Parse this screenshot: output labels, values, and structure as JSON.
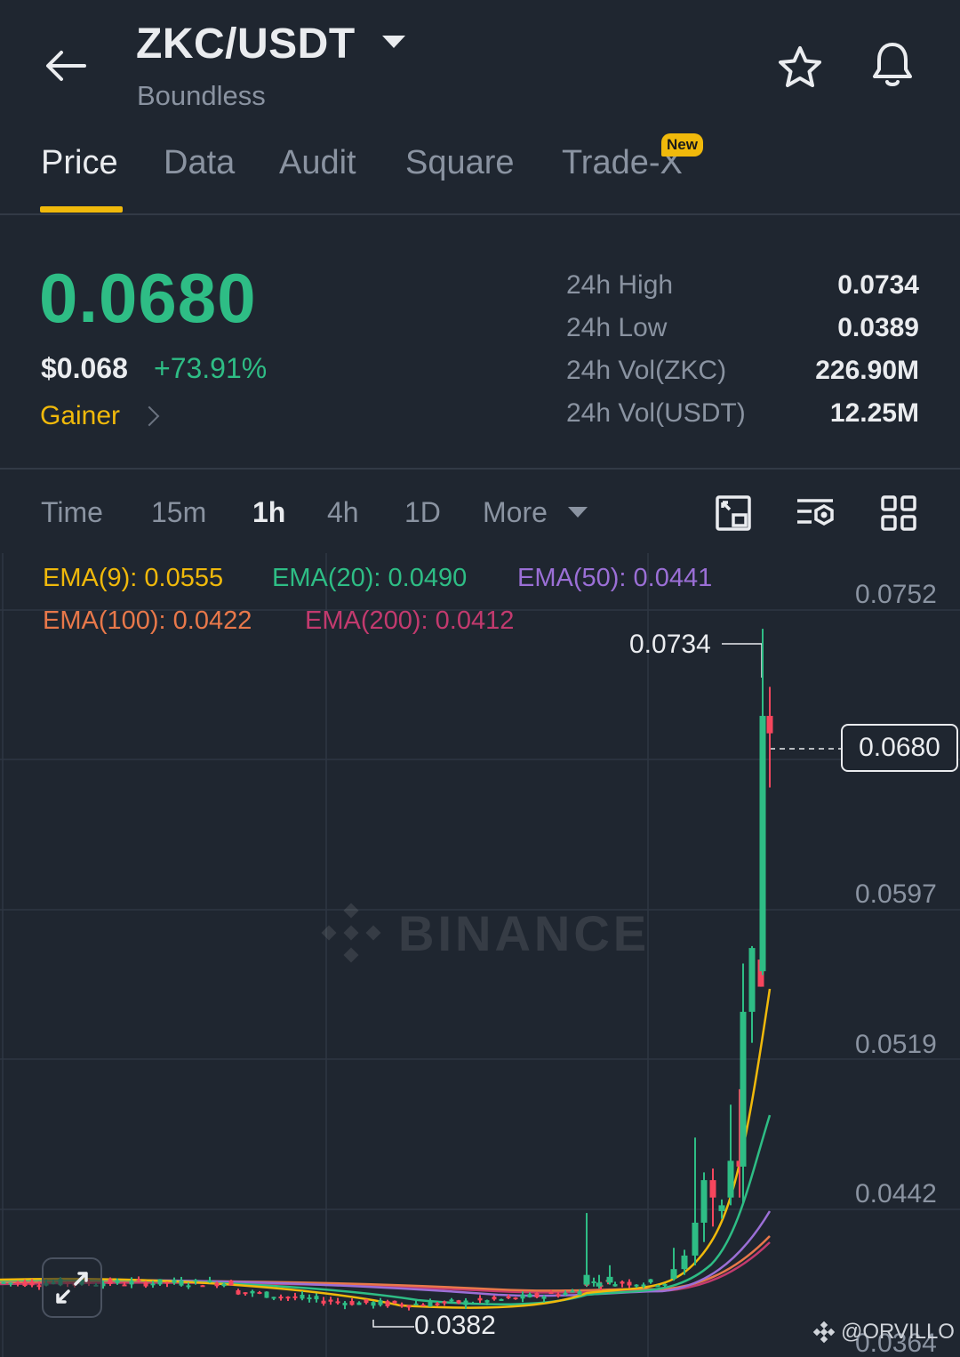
{
  "header": {
    "pair": "ZKC/USDT",
    "subtitle": "Boundless",
    "icons": [
      "back-arrow-icon",
      "caret-down-icon",
      "star-icon",
      "bell-icon"
    ]
  },
  "tabs": {
    "items": [
      {
        "label": "Price",
        "active": true
      },
      {
        "label": "Data"
      },
      {
        "label": "Audit"
      },
      {
        "label": "Square"
      },
      {
        "label": "Trade-X"
      }
    ],
    "new_badge": "New"
  },
  "price": {
    "last": "0.0680",
    "usd": "$0.068",
    "change": "+73.91%",
    "tag": "Gainer",
    "stats": [
      {
        "label": "24h High",
        "value": "0.0734"
      },
      {
        "label": "24h Low",
        "value": "0.0389"
      },
      {
        "label": "24h Vol(ZKC)",
        "value": "226.90M"
      },
      {
        "label": "24h Vol(USDT)",
        "value": "12.25M"
      }
    ]
  },
  "timeframes": {
    "items": [
      "Time",
      "15m",
      "1h",
      "4h",
      "1D",
      "More"
    ],
    "active": "1h",
    "tools": [
      "chart-type-icon",
      "indicator-settings-icon",
      "grid-layout-icon"
    ]
  },
  "chart": {
    "ema": [
      {
        "label": "EMA(9): 0.0555",
        "color": "#f0b90b"
      },
      {
        "label": "EMA(20): 0.0490",
        "color": "#2ebd85"
      },
      {
        "label": "EMA(50): 0.0441",
        "color": "#9b6fd6"
      },
      {
        "label": "EMA(100): 0.0422",
        "color": "#e8784a"
      },
      {
        "label": "EMA(200): 0.0412",
        "color": "#c23a6e"
      }
    ],
    "y_axis": [
      "0.0752",
      "0.0597",
      "0.0519",
      "0.0442",
      "0.0364"
    ],
    "current": "0.0680",
    "high_marker": "0.0734",
    "low_marker": "0.0382",
    "watermark": "BINANCE",
    "credit": "@ORVILLO",
    "up_color": "#2ebd85",
    "down_color": "#f6465d"
  },
  "chart_data": {
    "type": "candlestick",
    "interval": "1h",
    "ylim": [
      0.0364,
      0.0752
    ],
    "y_ticks": [
      0.0752,
      0.0597,
      0.0519,
      0.0442,
      0.0364
    ],
    "last_price": 0.068,
    "high": 0.0734,
    "low": 0.0382,
    "ema": {
      "EMA9": 0.0555,
      "EMA20": 0.049,
      "EMA50": 0.0441,
      "EMA100": 0.0422,
      "EMA200": 0.0412
    },
    "recent_candles": [
      {
        "open": 0.0395,
        "high": 0.0432,
        "low": 0.0394,
        "close": 0.04
      },
      {
        "open": 0.0394,
        "high": 0.04,
        "low": 0.0393,
        "close": 0.0396
      },
      {
        "open": 0.0396,
        "high": 0.0405,
        "low": 0.0395,
        "close": 0.0399
      },
      {
        "open": 0.0398,
        "high": 0.0414,
        "low": 0.0397,
        "close": 0.0403
      },
      {
        "open": 0.0403,
        "high": 0.0413,
        "low": 0.04,
        "close": 0.041
      },
      {
        "open": 0.041,
        "high": 0.0471,
        "low": 0.0405,
        "close": 0.0427
      },
      {
        "open": 0.0427,
        "high": 0.0453,
        "low": 0.0417,
        "close": 0.0449
      },
      {
        "open": 0.0449,
        "high": 0.0455,
        "low": 0.0425,
        "close": 0.044
      },
      {
        "open": 0.0433,
        "high": 0.0439,
        "low": 0.0429,
        "close": 0.0436
      },
      {
        "open": 0.044,
        "high": 0.0488,
        "low": 0.0436,
        "close": 0.0459
      },
      {
        "open": 0.0459,
        "high": 0.0496,
        "low": 0.044,
        "close": 0.0456
      },
      {
        "open": 0.0456,
        "high": 0.0561,
        "low": 0.0437,
        "close": 0.0536
      },
      {
        "open": 0.0536,
        "high": 0.057,
        "low": 0.052,
        "close": 0.0569
      },
      {
        "open": 0.0563,
        "high": 0.0562,
        "low": 0.0585,
        "close": 0.0549
      },
      {
        "open": 0.0557,
        "high": 0.0734,
        "low": 0.0555,
        "close": 0.0689
      },
      {
        "open": 0.0689,
        "high": 0.0704,
        "low": 0.0652,
        "close": 0.068
      }
    ]
  }
}
